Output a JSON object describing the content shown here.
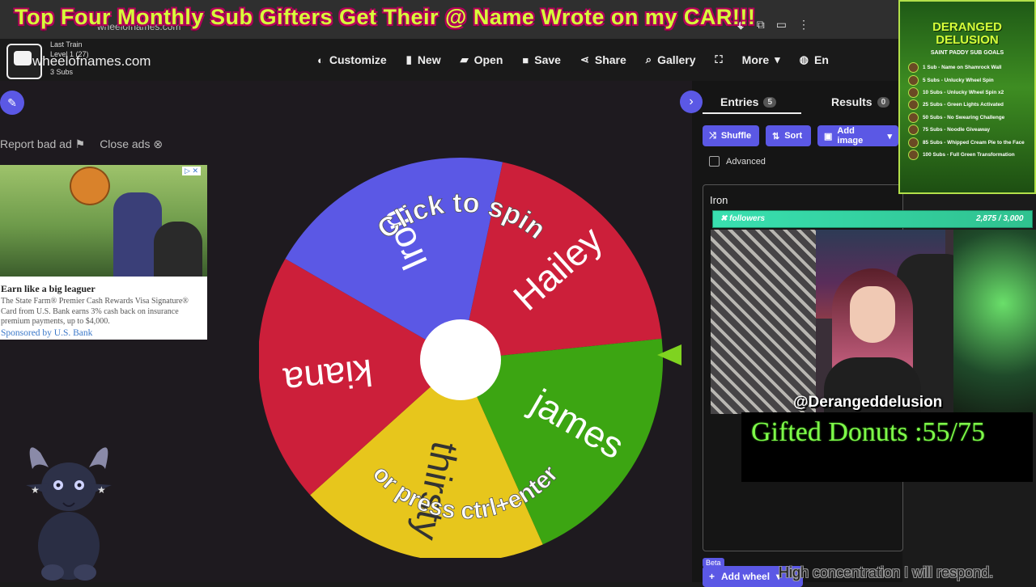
{
  "overlay": {
    "banner": "Top Four Monthly Sub Gifters Get Their @ Name Wrote on my CAR!!!",
    "train": {
      "title": "Last Train",
      "level": "Level 1 (27)",
      "subs": "3 Subs"
    },
    "goals": {
      "title_line1": "DERANGED",
      "title_line2": "DELUSION",
      "subtitle": "SAINT PADDY SUB GOALS",
      "items": [
        "1 Sub - Name on Shamrock Wall",
        "5 Subs - Unlucky Wheel Spin",
        "10 Subs - Unlucky Wheel Spin x2",
        "25 Subs - Green Lights Activated",
        "50 Subs - No Swearing Challenge",
        "75 Subs - Noodle Giveaway",
        "85 Subs - Whipped Cream Pie to the Face",
        "100 Subs - Full Green Transformation"
      ]
    },
    "followers": {
      "label": "followers",
      "count": "2,875 / 3,000",
      "progress": 0.958
    },
    "cam_name": "@Derangeddelusion",
    "donuts": "Gifted Donuts :55/75",
    "bottom_message": "High concentration I will respond."
  },
  "browser": {
    "url": "wheelofnames.com"
  },
  "app": {
    "site_name": "wheelofnames.com",
    "toolbar": [
      {
        "label": "Customize",
        "icon": "palette-icon"
      },
      {
        "label": "New",
        "icon": "file-icon"
      },
      {
        "label": "Open",
        "icon": "folder-icon"
      },
      {
        "label": "Save",
        "icon": "save-icon"
      },
      {
        "label": "Share",
        "icon": "share-icon"
      },
      {
        "label": "Gallery",
        "icon": "search-icon"
      },
      {
        "label": "",
        "icon": "fullscreen-icon"
      },
      {
        "label": "More",
        "icon": "chevron-down-icon"
      },
      {
        "label": "En",
        "icon": "globe-icon"
      }
    ]
  },
  "ad": {
    "report": "Report bad ad",
    "close": "Close ads",
    "headline": "Earn like a big leaguer",
    "body": "The State Farm® Premier Cash Rewards Visa Signature® Card from U.S. Bank earns 3% cash back on insurance premium payments, up to $4,000.",
    "sponsor": "Sponsored by U.S. Bank"
  },
  "wheel": {
    "spin_text_top": "Click to spin",
    "spin_text_bottom": "or press ctrl+enter",
    "segments": [
      {
        "label": "Hailey",
        "color": "#cc1f3a"
      },
      {
        "label": "james",
        "color": "#3ca512"
      },
      {
        "label": "thirsty",
        "color": "#e7c61c"
      },
      {
        "label": "kiana",
        "color": "#cc1f3a"
      },
      {
        "label": "Iron",
        "color": "#5b58e5"
      }
    ]
  },
  "panel": {
    "tabs": [
      {
        "label": "Entries",
        "count": "5"
      },
      {
        "label": "Results",
        "count": "0"
      }
    ],
    "buttons": {
      "shuffle": "Shuffle",
      "sort": "Sort",
      "add_image": "Add image"
    },
    "advanced": "Advanced",
    "entries": [
      "Iron"
    ],
    "beta": "Beta",
    "add_wheel": "Add wheel"
  }
}
